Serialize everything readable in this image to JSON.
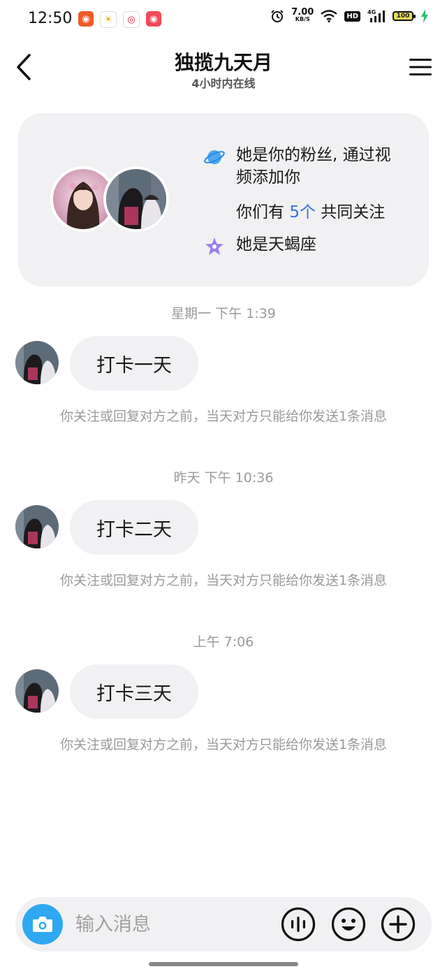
{
  "status_bar": {
    "time": "12:50",
    "net_speed_value": "7.00",
    "net_speed_unit": "KB/S",
    "hd_label": "HD",
    "network_label": "4G",
    "battery_level": "100",
    "app_icons": [
      "kuaishou-icon",
      "app-icon",
      "weibo-icon",
      "kuaishou-icon"
    ]
  },
  "header": {
    "title": "独揽九天月",
    "subtitle": "4小时内在线"
  },
  "profile_card": {
    "fan_info": "她是你的粉丝, 通过视频添加你",
    "mutual_prefix": "你们有 ",
    "mutual_count": "5个",
    "mutual_suffix": " 共同关注",
    "zodiac_info": "她是天蝎座"
  },
  "messages": [
    {
      "time": "星期一 下午 1:39",
      "text": "打卡一天",
      "notice": "你关注或回复对方之前，当天对方只能给你发送1条消息"
    },
    {
      "time": "昨天 下午 10:36",
      "text": "打卡二天",
      "notice": "你关注或回复对方之前，当天对方只能给你发送1条消息"
    },
    {
      "time": "上午 7:06",
      "text": "打卡三天",
      "notice": "你关注或回复对方之前，当天对方只能给你发送1条消息"
    }
  ],
  "input_bar": {
    "placeholder": "输入消息"
  },
  "colors": {
    "accent_blue": "#2fa8f2",
    "link_blue": "#3b6fd8",
    "bubble_bg": "#f1f1f3",
    "muted_text": "#9a9a9a"
  }
}
